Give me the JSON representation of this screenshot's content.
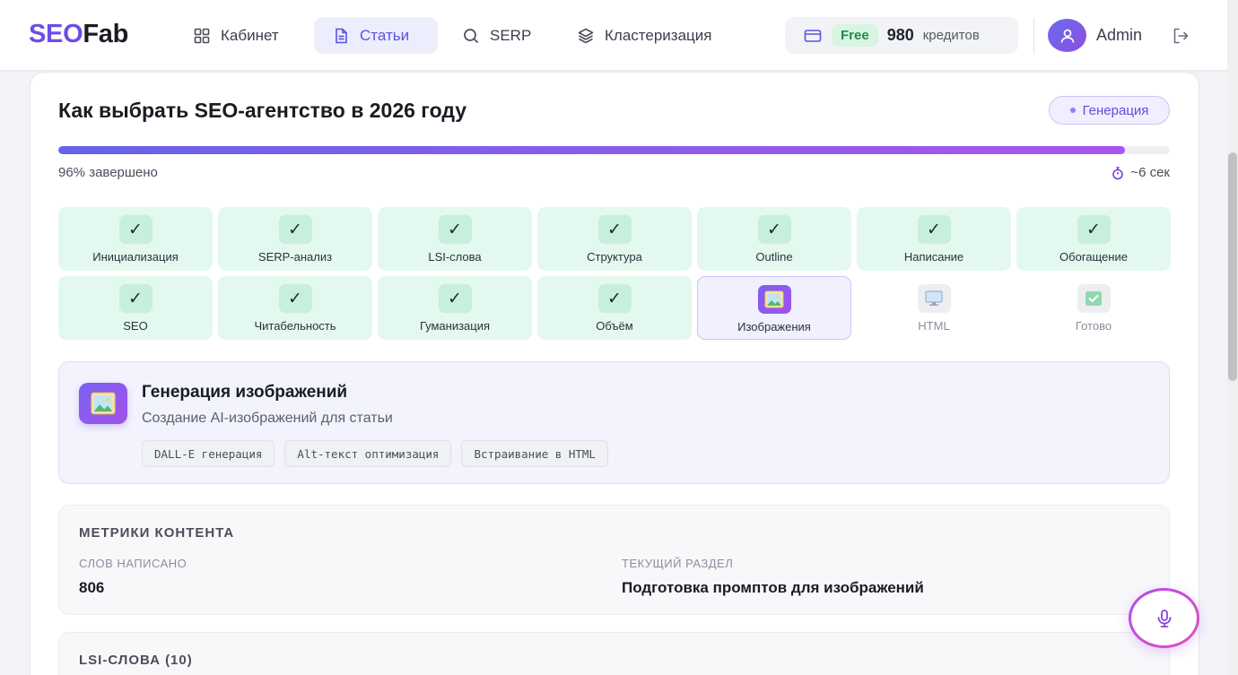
{
  "brand": {
    "part1": "SEO",
    "part2": "Fab"
  },
  "nav": [
    {
      "label": "Кабинет",
      "icon": "grid-icon",
      "active": false
    },
    {
      "label": "Статьи",
      "icon": "document-icon",
      "active": true
    },
    {
      "label": "SERP",
      "icon": "search-icon",
      "active": false
    },
    {
      "label": "Кластеризация",
      "icon": "layers-icon",
      "active": false
    }
  ],
  "credits": {
    "plan": "Free",
    "amount": "980",
    "unit": "кредитов",
    "icon": "credit-card-icon"
  },
  "user": {
    "name": "Admin",
    "avatar_icon": "user-icon",
    "logout_icon": "logout-icon"
  },
  "article": {
    "title": "Как выбрать SEO-агентство в 2026 году",
    "status_badge": "Генерация",
    "progress_percent": 96,
    "progress_label": "96% завершено",
    "eta": "~6 сек"
  },
  "steps": [
    {
      "label": "Инициализация",
      "state": "done"
    },
    {
      "label": "SERP-анализ",
      "state": "done"
    },
    {
      "label": "LSI-слова",
      "state": "done"
    },
    {
      "label": "Структура",
      "state": "done"
    },
    {
      "label": "Outline",
      "state": "done"
    },
    {
      "label": "Написание",
      "state": "done"
    },
    {
      "label": "Обогащение",
      "state": "done"
    },
    {
      "label": "SEO",
      "state": "done"
    },
    {
      "label": "Читабельность",
      "state": "done"
    },
    {
      "label": "Гуманизация",
      "state": "done"
    },
    {
      "label": "Объём",
      "state": "done"
    },
    {
      "label": "Изображения",
      "state": "active"
    },
    {
      "label": "HTML",
      "state": "pending"
    },
    {
      "label": "Готово",
      "state": "pending"
    }
  ],
  "step_check_glyph": "✓",
  "stage": {
    "title": "Генерация изображений",
    "subtitle": "Создание AI-изображений для статьи",
    "tags": [
      "DALL-E генерация",
      "Alt-текст оптимизация",
      "Встраивание в HTML"
    ]
  },
  "metrics": {
    "heading": "МЕТРИКИ КОНТЕНТА",
    "words_label": "СЛОВ НАПИСАНО",
    "words_value": "806",
    "section_label": "ТЕКУЩИЙ РАЗДЕЛ",
    "section_value": "Подготовка промптов для изображений"
  },
  "lsi": {
    "heading": "LSI-СЛОВА (10)"
  },
  "colors": {
    "accent": "#6d4ce8",
    "done_bg": "#e3f8ee",
    "active_border": "#c9c4f5"
  }
}
